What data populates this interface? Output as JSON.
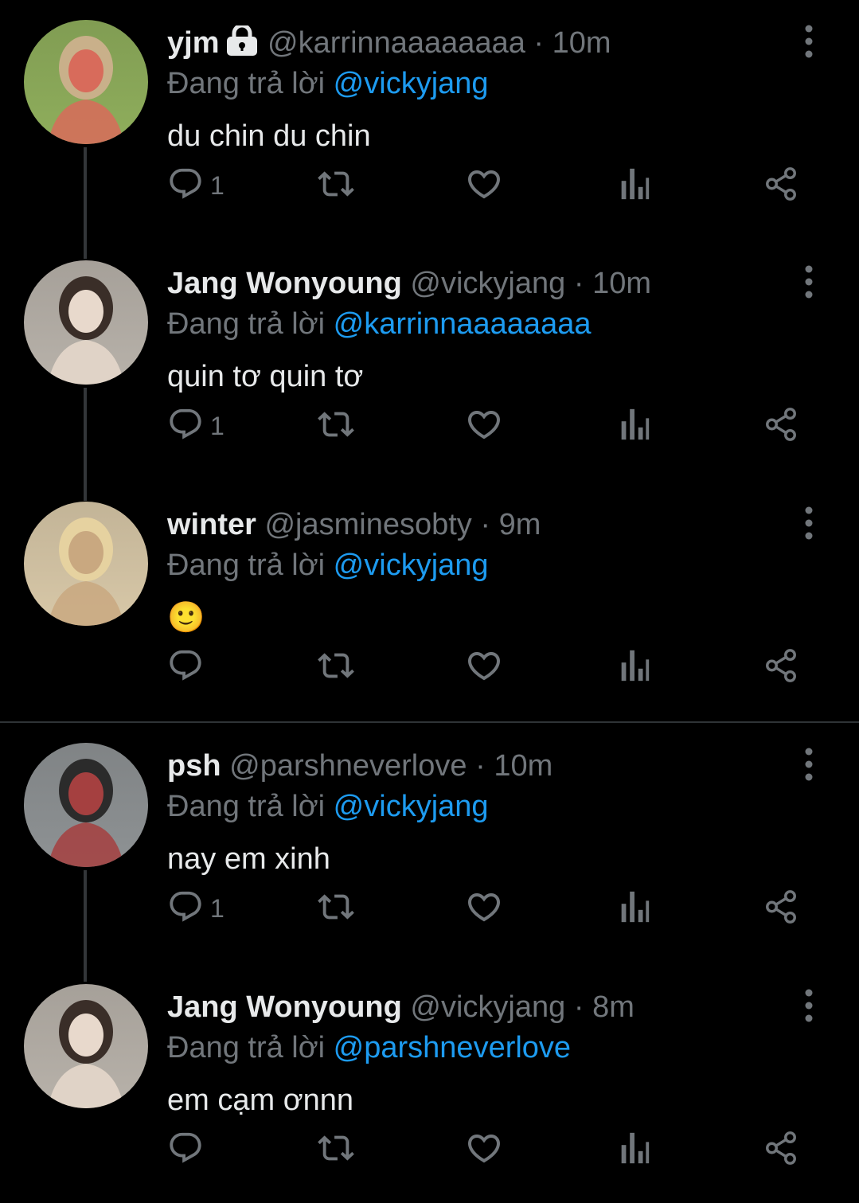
{
  "tweets": [
    {
      "name": "yjm",
      "locked": true,
      "handle": "@karrinnaaaaaaaa",
      "dot": "·",
      "time": "10m",
      "reply_prefix": "Đang trả lời",
      "reply_to": "@vickyjang",
      "text": "du chin du chin",
      "reply_count": "1",
      "avatar_colors": [
        "#8fae5c",
        "#c9b08a",
        "#d86b5b"
      ]
    },
    {
      "name": "Jang Wonyoung",
      "locked": false,
      "handle": "@vickyjang",
      "dot": "·",
      "time": "10m",
      "reply_prefix": "Đang trả lời",
      "reply_to": "@karrinnaaaaaaaa",
      "text": "quin tơ quin tơ",
      "reply_count": "1",
      "avatar_colors": [
        "#b8b2aa",
        "#3a2e28",
        "#e8d9cc"
      ]
    },
    {
      "name": "winter",
      "locked": false,
      "handle": "@jasminesobty",
      "dot": "·",
      "time": "9m",
      "reply_prefix": "Đang trả lời",
      "reply_to": "@vickyjang",
      "text": "🙂",
      "reply_count": "",
      "avatar_colors": [
        "#d8c8a8",
        "#e6d2a0",
        "#c9a880"
      ]
    },
    {
      "name": "psh",
      "locked": false,
      "handle": "@parshneverlove",
      "dot": "·",
      "time": "10m",
      "reply_prefix": "Đang trả lời",
      "reply_to": "@vickyjang",
      "text": "nay em xinh",
      "reply_count": "1",
      "avatar_colors": [
        "#8e9294",
        "#2b2b2b",
        "#a54040"
      ]
    },
    {
      "name": "Jang Wonyoung",
      "locked": false,
      "handle": "@vickyjang",
      "dot": "·",
      "time": "8m",
      "reply_prefix": "Đang trả lời",
      "reply_to": "@parshneverlove",
      "text": "em cạm ơnnn",
      "reply_count": "",
      "avatar_colors": [
        "#b8b2aa",
        "#3a2e28",
        "#e8d9cc"
      ]
    }
  ],
  "icons": {
    "reply": "reply-icon",
    "retweet": "retweet-icon",
    "like": "like-icon",
    "views": "views-icon",
    "share": "share-icon",
    "more": "more-icon",
    "lock": "lock-icon"
  },
  "colors": {
    "accent": "#1d9bf0",
    "muted": "#71767b",
    "text": "#e7e9ea",
    "background": "#000000"
  }
}
